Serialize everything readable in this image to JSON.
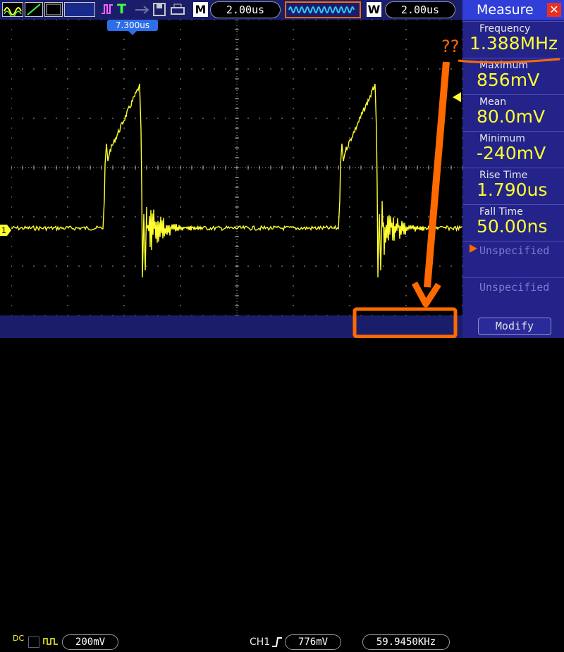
{
  "topbar": {
    "mode_letter": "M",
    "timebase": "2.00us",
    "window_letter": "W",
    "window_timebase": "2.00us",
    "run_state_glyph": "T",
    "accent_color": "#1a1e6a"
  },
  "screen": {
    "time_marker": "7.300us",
    "channel_marker": "1",
    "trace_color": "#ffff30"
  },
  "bottombar": {
    "coupling": "DC",
    "ch1_scale": "200mV",
    "trigger_source": "CH1",
    "trigger_level": "776mV",
    "trigger_frequency": "59.9450KHz"
  },
  "measure_panel": {
    "title": "Measure",
    "items": [
      {
        "label": "Frequency",
        "value": "1.388MHz"
      },
      {
        "label": "Maximum",
        "value": "856mV"
      },
      {
        "label": "Mean",
        "value": "80.0mV"
      },
      {
        "label": "Minimum",
        "value": "-240mV"
      },
      {
        "label": "Rise Time",
        "value": "1.790us"
      },
      {
        "label": "Fall Time",
        "value": "50.00ns"
      }
    ],
    "unspecified_1": "Unspecified",
    "unspecified_2": "Unspecified",
    "modify_label": "Modify"
  },
  "annotation": {
    "question_marks": "??",
    "color": "#ff6a00"
  }
}
